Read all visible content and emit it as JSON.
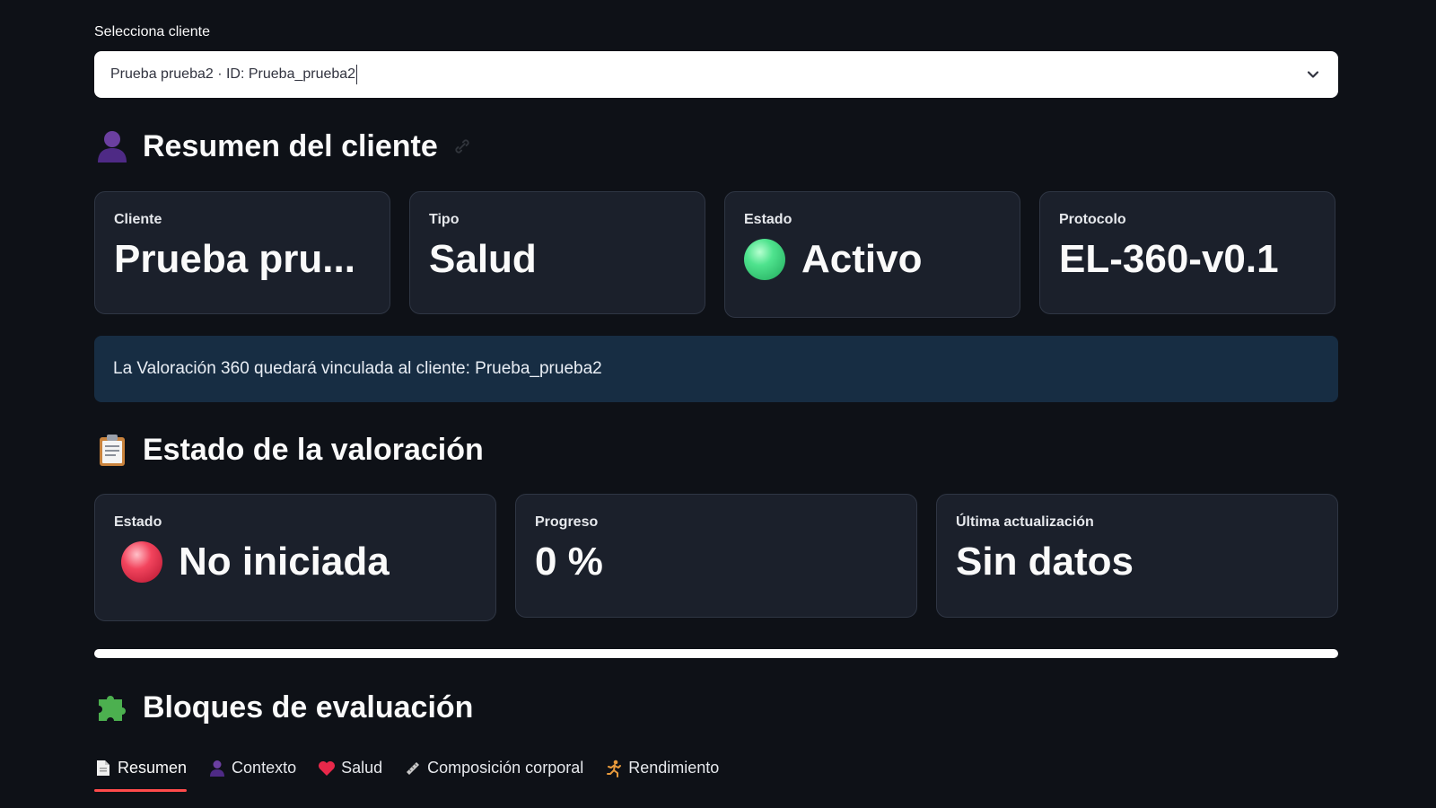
{
  "selector": {
    "label": "Selecciona cliente",
    "value": "Prueba prueba2 · ID: Prueba_prueba2"
  },
  "summary": {
    "title": "Resumen del cliente",
    "cards": [
      {
        "label": "Cliente",
        "value": "Prueba pru..."
      },
      {
        "label": "Tipo",
        "value": "Salud"
      },
      {
        "label": "Estado",
        "value": "Activo",
        "status_color": "#3ddc84"
      },
      {
        "label": "Protocolo",
        "value": "EL-360-v0.1"
      }
    ]
  },
  "info": {
    "text": "La Valoración 360 quedará vinculada al cliente: Prueba_prueba2"
  },
  "evaluation_status": {
    "title": "Estado de la valoración",
    "cards": [
      {
        "label": "Estado",
        "value": "No iniciada",
        "status_color": "#f2445d"
      },
      {
        "label": "Progreso",
        "value": "0 %"
      },
      {
        "label": "Última actualización",
        "value": "Sin datos"
      }
    ]
  },
  "blocks": {
    "title": "Bloques de evaluación",
    "tabs": [
      {
        "label": "Resumen",
        "icon": "document-icon",
        "active": true
      },
      {
        "label": "Contexto",
        "icon": "person-icon",
        "active": false
      },
      {
        "label": "Salud",
        "icon": "heart-icon",
        "active": false
      },
      {
        "label": "Composición corporal",
        "icon": "ruler-icon",
        "active": false
      },
      {
        "label": "Rendimiento",
        "icon": "runner-icon",
        "active": false
      }
    ]
  },
  "colors": {
    "background": "#0e1117",
    "card": "#1b202b",
    "info": "#172d43",
    "tab_accent": "#ff4b4b"
  }
}
